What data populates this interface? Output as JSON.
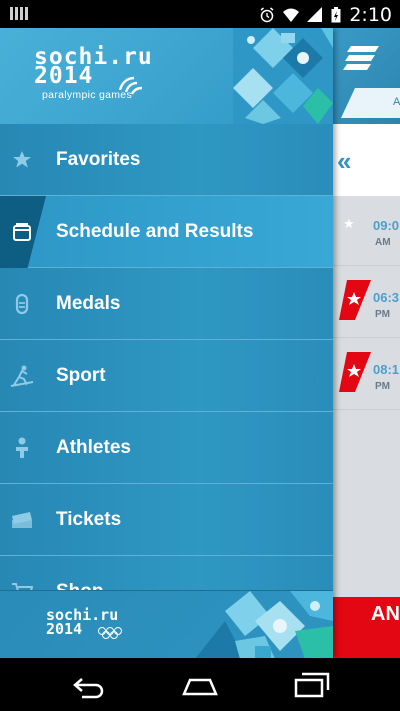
{
  "status_bar": {
    "time": "2:10",
    "icons": [
      "alarm-icon",
      "wifi-icon",
      "signal-icon",
      "battery-icon"
    ]
  },
  "header": {
    "logo_brand": "sochi.ru",
    "logo_year": "2014",
    "logo_subtitle": "paralympic games"
  },
  "menu": {
    "items": [
      {
        "label": "Favorites",
        "icon": "star-icon",
        "selected": false
      },
      {
        "label": "Schedule and Results",
        "icon": "calendar-icon",
        "selected": true
      },
      {
        "label": "Medals",
        "icon": "medal-icon",
        "selected": false
      },
      {
        "label": "Sport",
        "icon": "sport-icon",
        "selected": false
      },
      {
        "label": "Athletes",
        "icon": "athlete-icon",
        "selected": false
      },
      {
        "label": "Tickets",
        "icon": "ticket-icon",
        "selected": false
      },
      {
        "label": "Shop",
        "icon": "cart-icon",
        "selected": false
      }
    ]
  },
  "footer": {
    "logo_brand": "sochi.ru",
    "logo_year": "2014"
  },
  "schedule": {
    "tab_label": "A",
    "events": [
      {
        "time": "09:0",
        "ampm": "AM",
        "favorite": false
      },
      {
        "time": "06:3",
        "ampm": "PM",
        "favorite": true
      },
      {
        "time": "08:1",
        "ampm": "PM",
        "favorite": true
      }
    ],
    "promo_text": "AN"
  },
  "colors": {
    "drawer_blue": "#2b8fb9",
    "selected_tab": "#0e5d82",
    "accent_red": "#e30613"
  }
}
